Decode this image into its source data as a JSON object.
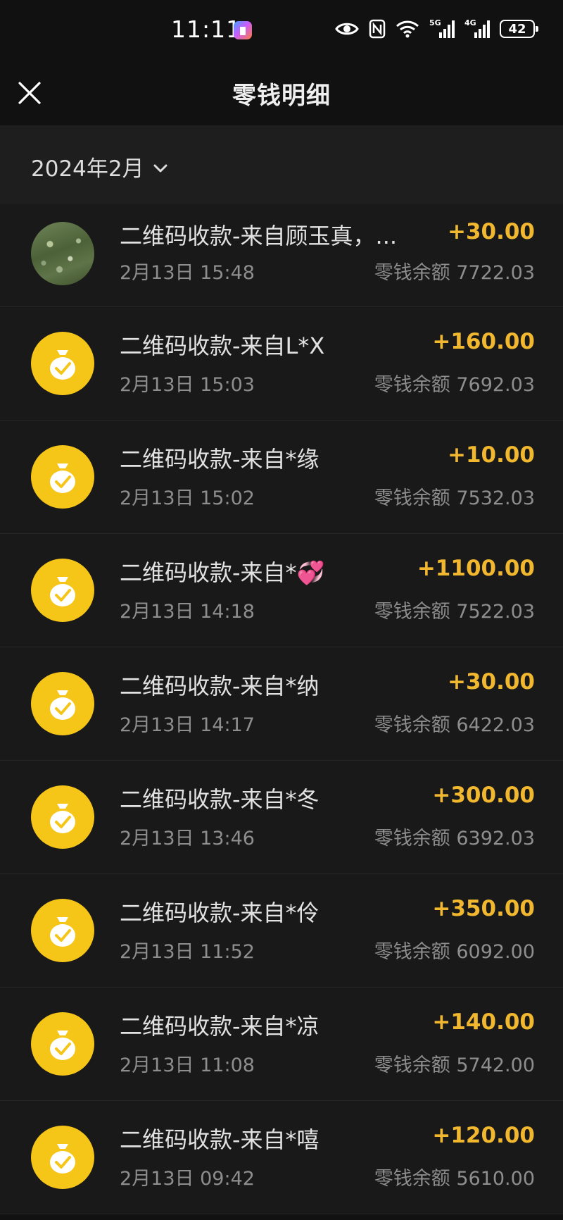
{
  "status_bar": {
    "time": "11:11",
    "network_5g": "5G",
    "network_4g": "4G",
    "battery": "42"
  },
  "header": {
    "title": "零钱明细",
    "close_icon": "close-icon"
  },
  "filter": {
    "month": "2024年2月"
  },
  "colors": {
    "amount": "#f0b72f",
    "coin": "#f5c518",
    "background": "#191919"
  },
  "transactions": [
    {
      "title": "二维码收款-来自顾玉真，...",
      "time": "2月13日 15:48",
      "amount": "+30.00",
      "balance": "零钱余额 7722.03",
      "icon": "user-photo-avatar"
    },
    {
      "title": "二维码收款-来自L*X",
      "time": "2月13日 15:03",
      "amount": "+160.00",
      "balance": "零钱余额 7692.03",
      "icon": "money-bag-icon"
    },
    {
      "title": "二维码收款-来自*缘",
      "time": "2月13日 15:02",
      "amount": "+10.00",
      "balance": "零钱余额 7532.03",
      "icon": "money-bag-icon"
    },
    {
      "title": "二维码收款-来自*💞",
      "time": "2月13日 14:18",
      "amount": "+1100.00",
      "balance": "零钱余额 7522.03",
      "icon": "money-bag-icon"
    },
    {
      "title": "二维码收款-来自*纳",
      "time": "2月13日 14:17",
      "amount": "+30.00",
      "balance": "零钱余额 6422.03",
      "icon": "money-bag-icon"
    },
    {
      "title": "二维码收款-来自*冬",
      "time": "2月13日 13:46",
      "amount": "+300.00",
      "balance": "零钱余额 6392.03",
      "icon": "money-bag-icon"
    },
    {
      "title": "二维码收款-来自*伶",
      "time": "2月13日 11:52",
      "amount": "+350.00",
      "balance": "零钱余额 6092.00",
      "icon": "money-bag-icon"
    },
    {
      "title": "二维码收款-来自*凉",
      "time": "2月13日 11:08",
      "amount": "+140.00",
      "balance": "零钱余额 5742.00",
      "icon": "money-bag-icon"
    },
    {
      "title": "二维码收款-来自*嘻",
      "time": "2月13日 09:42",
      "amount": "+120.00",
      "balance": "零钱余额 5610.00",
      "icon": "money-bag-icon"
    }
  ]
}
